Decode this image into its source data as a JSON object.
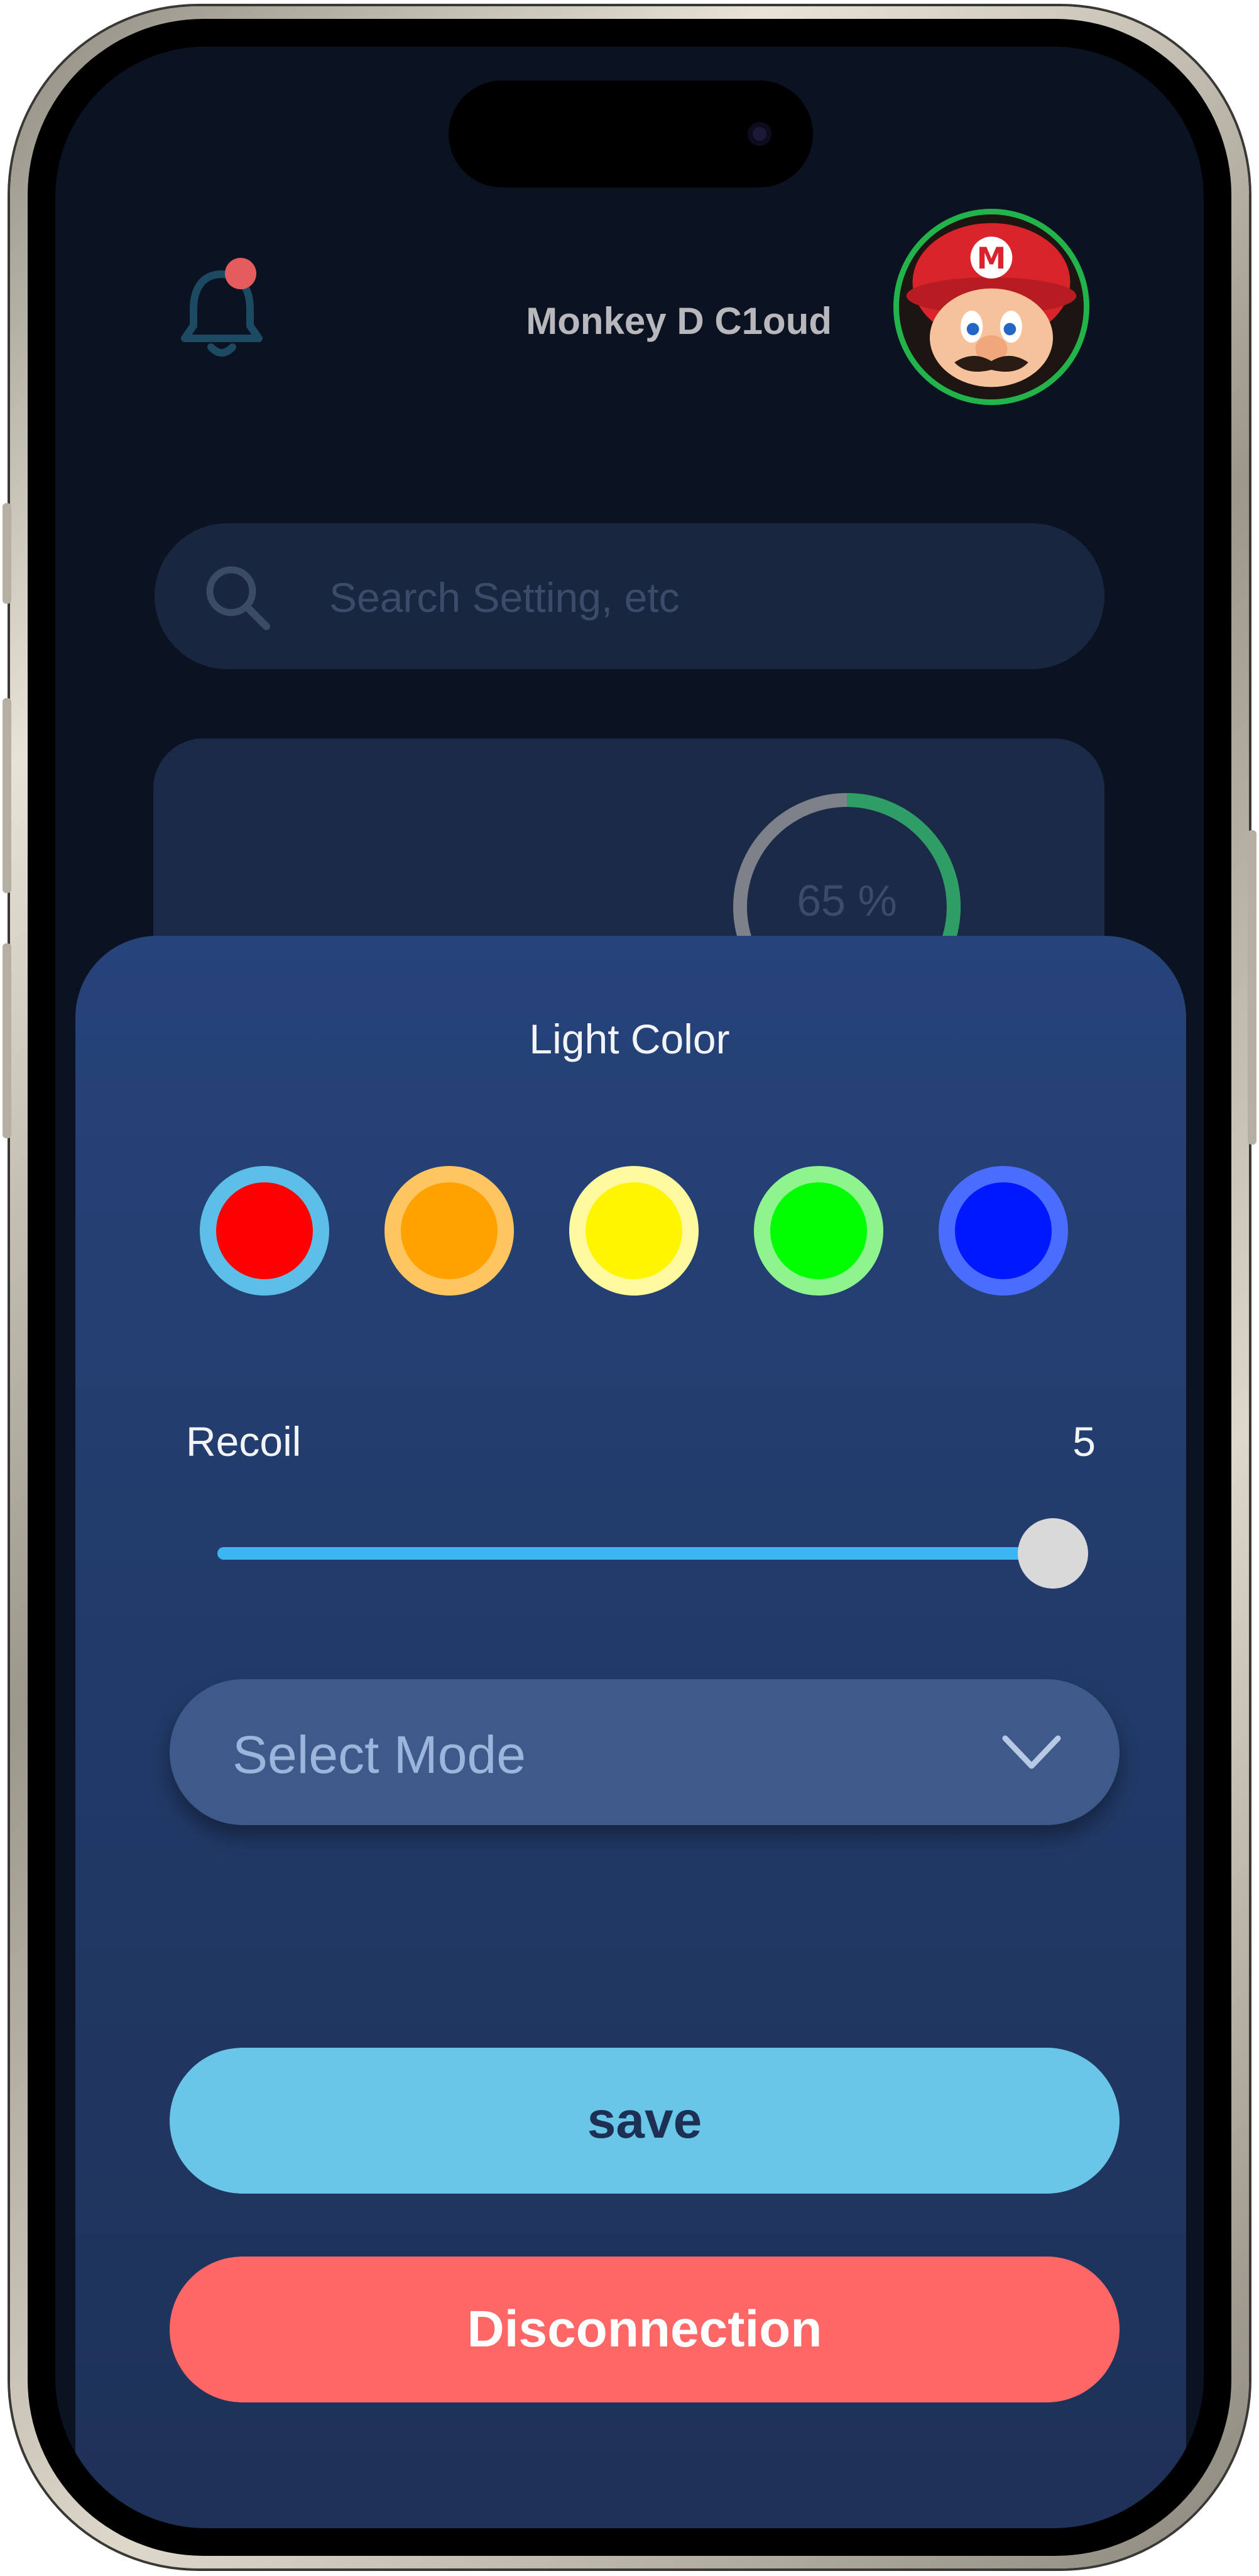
{
  "header": {
    "username": "Monkey D C1oud",
    "notification_icon": "bell-icon",
    "avatar_icon": "mario-avatar",
    "avatar_border_color": "#22b44a"
  },
  "search": {
    "placeholder": "Search Setting, etc",
    "icon": "search-icon"
  },
  "status_card": {
    "progress_label": "65 %",
    "progress_value": 65
  },
  "sheet": {
    "title": "Light Color",
    "colors": [
      {
        "name": "red",
        "fill": "#ff0000",
        "ring": "#5bbfe8",
        "selected": true
      },
      {
        "name": "orange",
        "fill": "#ffa200",
        "ring": "#ffc560"
      },
      {
        "name": "yellow",
        "fill": "#fff500",
        "ring": "#fffaa0"
      },
      {
        "name": "green",
        "fill": "#00ff00",
        "ring": "#8ef58e"
      },
      {
        "name": "blue",
        "fill": "#0018ff",
        "ring": "#4a6cff"
      }
    ],
    "recoil": {
      "label": "Recoil",
      "value": "5",
      "slider_fraction": 1.0,
      "track_color": "#3bb6f2"
    },
    "mode_select": {
      "placeholder": "Select Mode",
      "icon": "chevron-down-icon"
    },
    "save_label": "save",
    "disconnect_label": "Disconnection"
  }
}
